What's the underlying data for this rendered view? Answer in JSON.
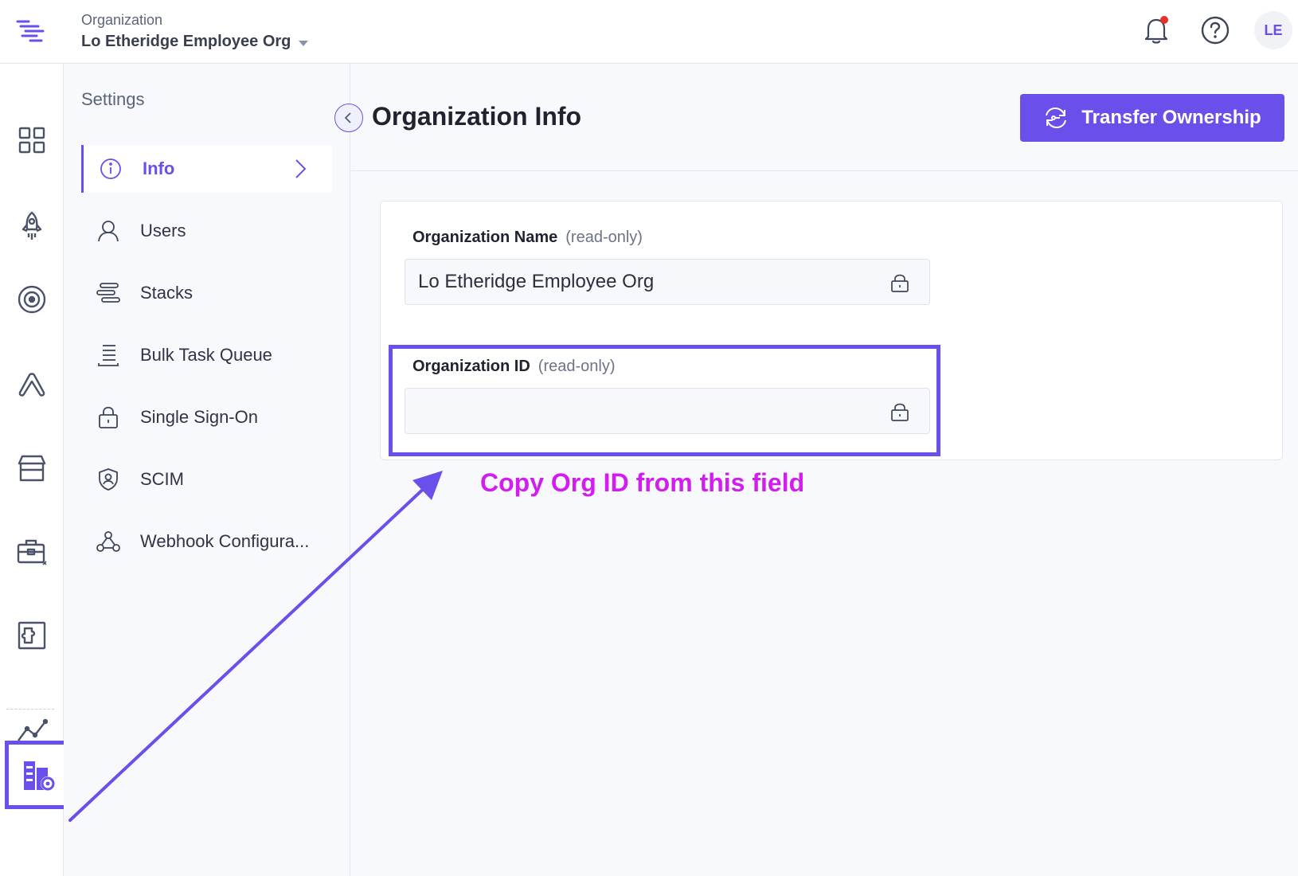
{
  "header": {
    "org_caption": "Organization",
    "org_name": "Lo Etheridge Employee Org",
    "avatar_initials": "LE",
    "notification_dot_color": "#e5312a"
  },
  "rail": {
    "icons": [
      "dashboard-icon",
      "rocket-icon",
      "target-icon",
      "automation-icon",
      "marketplace-icon",
      "toolbox-icon",
      "extensions-icon",
      "analytics-icon",
      "org-settings-icon"
    ],
    "active": "org-settings-icon"
  },
  "settings": {
    "title": "Settings",
    "items": [
      {
        "label": "Info",
        "icon": "info-icon",
        "active": true
      },
      {
        "label": "Users",
        "icon": "user-icon"
      },
      {
        "label": "Stacks",
        "icon": "stacks-icon"
      },
      {
        "label": "Bulk Task Queue",
        "icon": "queue-icon"
      },
      {
        "label": "Single Sign-On",
        "icon": "lock-icon"
      },
      {
        "label": "SCIM",
        "icon": "shield-user-icon"
      },
      {
        "label": "Webhook Configura...",
        "icon": "webhook-icon"
      }
    ]
  },
  "main": {
    "title": "Organization Info",
    "transfer_button": "Transfer Ownership",
    "fields": {
      "name_label": "Organization Name",
      "name_note": "(read-only)",
      "name_value": "Lo Etheridge Employee Org",
      "id_label": "Organization ID",
      "id_note": "(read-only)",
      "id_value": ""
    }
  },
  "annotation": {
    "text": "Copy Org ID from this field",
    "color": "#d31cf0",
    "accent": "#6a4feb"
  }
}
